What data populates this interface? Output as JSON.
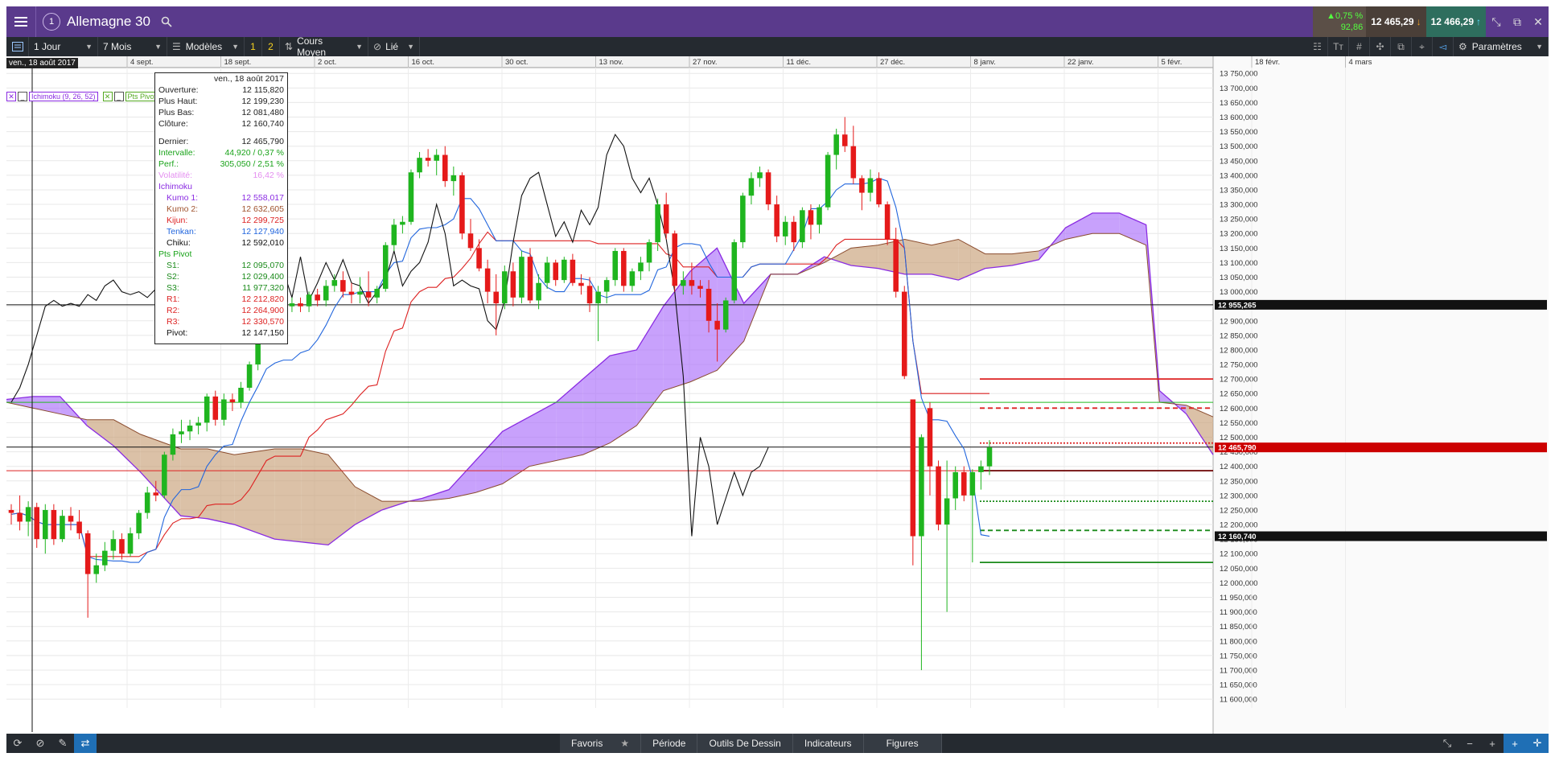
{
  "header": {
    "instrument": "Allemagne 30",
    "window_num": "1",
    "change_pct": "▲0,75 %",
    "change_pts": "92,86",
    "bid": "12 465,29",
    "ask": "12 466,29"
  },
  "toolbar": {
    "interval": "1 Jour",
    "range": "7 Mois",
    "templates": "Modèles",
    "badge1": "1",
    "badge2": "2",
    "price_type": "Cours Moyen",
    "link": "Lié",
    "settings": "Paramètres"
  },
  "footer": {
    "tabs": [
      "Favoris",
      "Période",
      "Outils De Dessin",
      "Indicateurs",
      "Figures"
    ]
  },
  "chart_data": {
    "type": "candlestick",
    "current_date_badge": "ven., 18 août 2017",
    "x_labels": [
      "4 sept.",
      "18 sept.",
      "2 oct.",
      "16 oct.",
      "30 oct.",
      "13 nov.",
      "27 nov.",
      "11 déc.",
      "27 déc.",
      "8 janv.",
      "22 janv.",
      "5 févr.",
      "18 févr.",
      "4 mars"
    ],
    "y_ticks": [
      "13 750,000",
      "13 700,000",
      "13 650,000",
      "13 600,000",
      "13 550,000",
      "13 500,000",
      "13 450,000",
      "13 400,000",
      "13 350,000",
      "13 300,000",
      "13 250,000",
      "13 200,000",
      "13 150,000",
      "13 100,000",
      "13 050,000",
      "13 000,000",
      "12 950,000",
      "12 900,000",
      "12 850,000",
      "12 800,000",
      "12 750,000",
      "12 700,000",
      "12 650,000",
      "12 600,000",
      "12 550,000",
      "12 500,000",
      "12 450,000",
      "12 400,000",
      "12 350,000",
      "12 300,000",
      "12 250,000",
      "12 200,000",
      "12 150,000",
      "12 100,000",
      "12 050,000",
      "12 000,000",
      "11 950,000",
      "11 900,000",
      "11 850,000",
      "11 800,000",
      "11 750,000",
      "11 700,000",
      "11 650,000",
      "11 600,000"
    ],
    "ylim": [
      11570,
      13770
    ],
    "price_tags": [
      {
        "label": "12 955,265",
        "value": 12955,
        "color": "#111111"
      },
      {
        "label": "12 465,790",
        "value": 12465,
        "color": "#cc0000"
      },
      {
        "label": "12 160,740",
        "value": 12160,
        "color": "#111111"
      }
    ],
    "indicators": [
      "Ichimoku (9, 26, 52)",
      "Pts Pivot"
    ],
    "tooltip": {
      "date": "ven., 18 août 2017",
      "ohlc": [
        {
          "k": "Ouverture:",
          "v": "12 115,820"
        },
        {
          "k": "Plus Haut:",
          "v": "12 199,230"
        },
        {
          "k": "Plus Bas:",
          "v": "12 081,480"
        },
        {
          "k": "Clôture:",
          "v": "12 160,740"
        }
      ],
      "last": {
        "k": "Dernier:",
        "v": "12 465,790"
      },
      "interval": {
        "k": "Intervalle:",
        "v": "44,920 / 0,37 %"
      },
      "perf": {
        "k": "Perf.:",
        "v": "305,050 / 2,51 %"
      },
      "vol": {
        "k": "Volatilité:",
        "v": "16,42 %"
      },
      "ichimoku_title": "Ichimoku",
      "ichimoku": [
        {
          "k": "Kumo 1:",
          "v": "12 558,017",
          "c": "#8a2be2"
        },
        {
          "k": "Kumo 2:",
          "v": "12 632,605",
          "c": "#a0522d"
        },
        {
          "k": "Kijun:",
          "v": "12 299,725",
          "c": "#dd2222"
        },
        {
          "k": "Tenkan:",
          "v": "12 127,940",
          "c": "#2266dd"
        },
        {
          "k": "Chiku:",
          "v": "12 592,010",
          "c": "#111111"
        }
      ],
      "pivot_title": "Pts Pivot",
      "pivots": [
        {
          "k": "S1:",
          "v": "12 095,070",
          "c": "#1a8a1a"
        },
        {
          "k": "S2:",
          "v": "12 029,400",
          "c": "#1a8a1a"
        },
        {
          "k": "S3:",
          "v": "11 977,320",
          "c": "#1a8a1a"
        },
        {
          "k": "R1:",
          "v": "12 212,820",
          "c": "#dd2222"
        },
        {
          "k": "R2:",
          "v": "12 264,900",
          "c": "#dd2222"
        },
        {
          "k": "R3:",
          "v": "12 330,570",
          "c": "#dd2222"
        },
        {
          "k": "Pivot:",
          "v": "12 147,150",
          "c": "#111111"
        }
      ]
    },
    "candles": [
      [
        12250,
        12270,
        12200,
        12240
      ],
      [
        12240,
        12300,
        12180,
        12210
      ],
      [
        12210,
        12280,
        12160,
        12260
      ],
      [
        12260,
        12275,
        12120,
        12150
      ],
      [
        12150,
        12270,
        12100,
        12250
      ],
      [
        12250,
        12270,
        12130,
        12150
      ],
      [
        12150,
        12250,
        12140,
        12230
      ],
      [
        12230,
        12260,
        12180,
        12210
      ],
      [
        12210,
        12250,
        12150,
        12170
      ],
      [
        12170,
        12180,
        11880,
        12030
      ],
      [
        12030,
        12100,
        12000,
        12060
      ],
      [
        12060,
        12140,
        12040,
        12110
      ],
      [
        12110,
        12180,
        12080,
        12150
      ],
      [
        12150,
        12170,
        12080,
        12100
      ],
      [
        12100,
        12190,
        12090,
        12170
      ],
      [
        12170,
        12250,
        12150,
        12240
      ],
      [
        12240,
        12330,
        12220,
        12310
      ],
      [
        12310,
        12350,
        12280,
        12300
      ],
      [
        12300,
        12450,
        12290,
        12440
      ],
      [
        12440,
        12530,
        12420,
        12510
      ],
      [
        12510,
        12560,
        12480,
        12520
      ],
      [
        12520,
        12560,
        12490,
        12540
      ],
      [
        12540,
        12570,
        12510,
        12550
      ],
      [
        12550,
        12650,
        12520,
        12640
      ],
      [
        12640,
        12660,
        12540,
        12560
      ],
      [
        12560,
        12650,
        12540,
        12630
      ],
      [
        12630,
        12650,
        12590,
        12620
      ],
      [
        12620,
        12690,
        12600,
        12670
      ],
      [
        12670,
        12760,
        12660,
        12750
      ],
      [
        12750,
        12860,
        12730,
        12850
      ],
      [
        12850,
        12960,
        12830,
        12950
      ],
      [
        12950,
        12990,
        12920,
        12970
      ],
      [
        12970,
        12990,
        12910,
        12950
      ],
      [
        12950,
        12980,
        12930,
        12960
      ],
      [
        12960,
        12980,
        12930,
        12950
      ],
      [
        12950,
        13000,
        12930,
        12990
      ],
      [
        12990,
        13010,
        12950,
        12970
      ],
      [
        12970,
        13040,
        12950,
        13020
      ],
      [
        13020,
        13060,
        13000,
        13040
      ],
      [
        13040,
        13070,
        12980,
        13000
      ],
      [
        13000,
        13030,
        12960,
        12990
      ],
      [
        12990,
        13050,
        12960,
        13000
      ],
      [
        13000,
        13070,
        12950,
        12980
      ],
      [
        12980,
        13020,
        12960,
        13010
      ],
      [
        13010,
        13170,
        13000,
        13160
      ],
      [
        13160,
        13250,
        13140,
        13230
      ],
      [
        13230,
        13260,
        13200,
        13240
      ],
      [
        13240,
        13420,
        13230,
        13410
      ],
      [
        13410,
        13480,
        13390,
        13460
      ],
      [
        13460,
        13490,
        13430,
        13450
      ],
      [
        13450,
        13490,
        13400,
        13470
      ],
      [
        13470,
        13500,
        13360,
        13380
      ],
      [
        13380,
        13430,
        13330,
        13400
      ],
      [
        13400,
        13410,
        13180,
        13200
      ],
      [
        13200,
        13250,
        13140,
        13150
      ],
      [
        13150,
        13180,
        13070,
        13080
      ],
      [
        13080,
        13110,
        12960,
        13000
      ],
      [
        13000,
        13060,
        12850,
        12960
      ],
      [
        12960,
        13090,
        12940,
        13070
      ],
      [
        13070,
        13100,
        12950,
        12980
      ],
      [
        12980,
        13140,
        12960,
        13120
      ],
      [
        13120,
        13150,
        12960,
        12970
      ],
      [
        12970,
        13060,
        12940,
        13030
      ],
      [
        13030,
        13120,
        13010,
        13100
      ],
      [
        13100,
        13110,
        13020,
        13040
      ],
      [
        13040,
        13120,
        13030,
        13110
      ],
      [
        13110,
        13130,
        13020,
        13030
      ],
      [
        13030,
        13060,
        12990,
        13020
      ],
      [
        13020,
        13050,
        12930,
        12960
      ],
      [
        12960,
        13020,
        12830,
        13000
      ],
      [
        13000,
        13050,
        12960,
        13040
      ],
      [
        13040,
        13150,
        13020,
        13140
      ],
      [
        13140,
        13150,
        13000,
        13020
      ],
      [
        13020,
        13080,
        13000,
        13070
      ],
      [
        13070,
        13120,
        13040,
        13100
      ],
      [
        13100,
        13180,
        13070,
        13170
      ],
      [
        13170,
        13320,
        13140,
        13300
      ],
      [
        13300,
        13340,
        13180,
        13200
      ],
      [
        13200,
        13210,
        13000,
        13020
      ],
      [
        13020,
        13070,
        12990,
        13040
      ],
      [
        13040,
        13100,
        12990,
        13020
      ],
      [
        13020,
        13040,
        12980,
        13010
      ],
      [
        13010,
        13040,
        12860,
        12900
      ],
      [
        12900,
        12960,
        12760,
        12870
      ],
      [
        12870,
        12980,
        12860,
        12970
      ],
      [
        12970,
        13180,
        12960,
        13170
      ],
      [
        13170,
        13340,
        13150,
        13330
      ],
      [
        13330,
        13410,
        13300,
        13390
      ],
      [
        13390,
        13430,
        13360,
        13410
      ],
      [
        13410,
        13420,
        13280,
        13300
      ],
      [
        13300,
        13330,
        13170,
        13190
      ],
      [
        13190,
        13260,
        13160,
        13240
      ],
      [
        13240,
        13260,
        13140,
        13170
      ],
      [
        13170,
        13290,
        13150,
        13280
      ],
      [
        13280,
        13300,
        13180,
        13230
      ],
      [
        13230,
        13300,
        13200,
        13290
      ],
      [
        13290,
        13480,
        13280,
        13470
      ],
      [
        13470,
        13560,
        13420,
        13540
      ],
      [
        13540,
        13600,
        13480,
        13500
      ],
      [
        13500,
        13570,
        13370,
        13390
      ],
      [
        13390,
        13400,
        13280,
        13340
      ],
      [
        13340,
        13420,
        13310,
        13390
      ],
      [
        13390,
        13410,
        13290,
        13300
      ],
      [
        13300,
        13310,
        13160,
        13180
      ],
      [
        13180,
        13220,
        12980,
        13000
      ],
      [
        13000,
        13020,
        12700,
        12710
      ],
      [
        12630,
        12630,
        12060,
        12160
      ],
      [
        12160,
        12510,
        11700,
        12500
      ],
      [
        12600,
        12620,
        12300,
        12400
      ],
      [
        12400,
        12420,
        12180,
        12200
      ],
      [
        12200,
        12420,
        11900,
        12290
      ],
      [
        12290,
        12400,
        12250,
        12380
      ],
      [
        12380,
        12400,
        12280,
        12300
      ],
      [
        12300,
        12390,
        12070,
        12380
      ],
      [
        12380,
        12420,
        12320,
        12400
      ],
      [
        12400,
        12490,
        12370,
        12465
      ]
    ],
    "series": [
      {
        "name": "Tenkan",
        "color": "#2266dd"
      },
      {
        "name": "Kijun",
        "color": "#dd2222"
      },
      {
        "name": "Chiku",
        "color": "#111111"
      }
    ],
    "pivot_levels": [
      {
        "value": 12700,
        "color": "#dd2222",
        "dash": "solid"
      },
      {
        "value": 12600,
        "color": "#dd2222",
        "dash": "dashed"
      },
      {
        "value": 12480,
        "color": "#dd2222",
        "dash": "dotted"
      },
      {
        "value": 12385,
        "color": "#6b0000",
        "dash": "solid"
      },
      {
        "value": 12280,
        "color": "#1a8a1a",
        "dash": "dotted"
      },
      {
        "value": 12180,
        "color": "#1a8a1a",
        "dash": "dashed"
      },
      {
        "value": 12070,
        "color": "#1a8a1a",
        "dash": "solid"
      }
    ],
    "hlines": [
      {
        "value": 12955,
        "color": "#111111"
      },
      {
        "value": 12466,
        "color": "#111111"
      },
      {
        "value": 12620,
        "color": "#22bb22"
      },
      {
        "value": 12385,
        "color": "#dd2222"
      }
    ]
  }
}
